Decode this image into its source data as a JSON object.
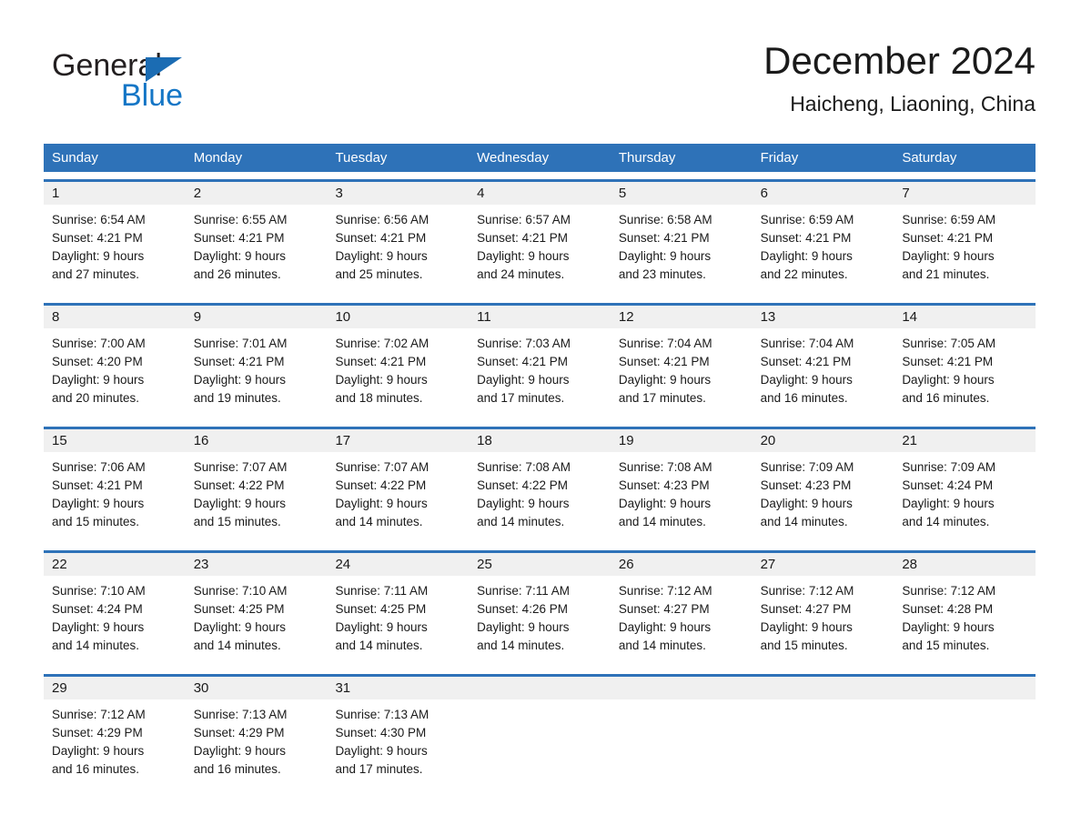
{
  "brand": {
    "name_part1": "General",
    "name_part2": "Blue"
  },
  "header": {
    "month_title": "December 2024",
    "location": "Haicheng, Liaoning, China"
  },
  "colors": {
    "header_blue": "#2e72b8",
    "row_divider_blue": "#2e72b8",
    "day_band_gray": "#f0f0f0",
    "logo_blue": "#1476c6",
    "text": "#1a1a1a"
  },
  "weekday_headers": [
    "Sunday",
    "Monday",
    "Tuesday",
    "Wednesday",
    "Thursday",
    "Friday",
    "Saturday"
  ],
  "weeks": [
    {
      "numbers": [
        "1",
        "2",
        "3",
        "4",
        "5",
        "6",
        "7"
      ],
      "days": [
        {
          "sunrise": "Sunrise: 6:54 AM",
          "sunset": "Sunset: 4:21 PM",
          "daylight1": "Daylight: 9 hours",
          "daylight2": "and 27 minutes."
        },
        {
          "sunrise": "Sunrise: 6:55 AM",
          "sunset": "Sunset: 4:21 PM",
          "daylight1": "Daylight: 9 hours",
          "daylight2": "and 26 minutes."
        },
        {
          "sunrise": "Sunrise: 6:56 AM",
          "sunset": "Sunset: 4:21 PM",
          "daylight1": "Daylight: 9 hours",
          "daylight2": "and 25 minutes."
        },
        {
          "sunrise": "Sunrise: 6:57 AM",
          "sunset": "Sunset: 4:21 PM",
          "daylight1": "Daylight: 9 hours",
          "daylight2": "and 24 minutes."
        },
        {
          "sunrise": "Sunrise: 6:58 AM",
          "sunset": "Sunset: 4:21 PM",
          "daylight1": "Daylight: 9 hours",
          "daylight2": "and 23 minutes."
        },
        {
          "sunrise": "Sunrise: 6:59 AM",
          "sunset": "Sunset: 4:21 PM",
          "daylight1": "Daylight: 9 hours",
          "daylight2": "and 22 minutes."
        },
        {
          "sunrise": "Sunrise: 6:59 AM",
          "sunset": "Sunset: 4:21 PM",
          "daylight1": "Daylight: 9 hours",
          "daylight2": "and 21 minutes."
        }
      ]
    },
    {
      "numbers": [
        "8",
        "9",
        "10",
        "11",
        "12",
        "13",
        "14"
      ],
      "days": [
        {
          "sunrise": "Sunrise: 7:00 AM",
          "sunset": "Sunset: 4:20 PM",
          "daylight1": "Daylight: 9 hours",
          "daylight2": "and 20 minutes."
        },
        {
          "sunrise": "Sunrise: 7:01 AM",
          "sunset": "Sunset: 4:21 PM",
          "daylight1": "Daylight: 9 hours",
          "daylight2": "and 19 minutes."
        },
        {
          "sunrise": "Sunrise: 7:02 AM",
          "sunset": "Sunset: 4:21 PM",
          "daylight1": "Daylight: 9 hours",
          "daylight2": "and 18 minutes."
        },
        {
          "sunrise": "Sunrise: 7:03 AM",
          "sunset": "Sunset: 4:21 PM",
          "daylight1": "Daylight: 9 hours",
          "daylight2": "and 17 minutes."
        },
        {
          "sunrise": "Sunrise: 7:04 AM",
          "sunset": "Sunset: 4:21 PM",
          "daylight1": "Daylight: 9 hours",
          "daylight2": "and 17 minutes."
        },
        {
          "sunrise": "Sunrise: 7:04 AM",
          "sunset": "Sunset: 4:21 PM",
          "daylight1": "Daylight: 9 hours",
          "daylight2": "and 16 minutes."
        },
        {
          "sunrise": "Sunrise: 7:05 AM",
          "sunset": "Sunset: 4:21 PM",
          "daylight1": "Daylight: 9 hours",
          "daylight2": "and 16 minutes."
        }
      ]
    },
    {
      "numbers": [
        "15",
        "16",
        "17",
        "18",
        "19",
        "20",
        "21"
      ],
      "days": [
        {
          "sunrise": "Sunrise: 7:06 AM",
          "sunset": "Sunset: 4:21 PM",
          "daylight1": "Daylight: 9 hours",
          "daylight2": "and 15 minutes."
        },
        {
          "sunrise": "Sunrise: 7:07 AM",
          "sunset": "Sunset: 4:22 PM",
          "daylight1": "Daylight: 9 hours",
          "daylight2": "and 15 minutes."
        },
        {
          "sunrise": "Sunrise: 7:07 AM",
          "sunset": "Sunset: 4:22 PM",
          "daylight1": "Daylight: 9 hours",
          "daylight2": "and 14 minutes."
        },
        {
          "sunrise": "Sunrise: 7:08 AM",
          "sunset": "Sunset: 4:22 PM",
          "daylight1": "Daylight: 9 hours",
          "daylight2": "and 14 minutes."
        },
        {
          "sunrise": "Sunrise: 7:08 AM",
          "sunset": "Sunset: 4:23 PM",
          "daylight1": "Daylight: 9 hours",
          "daylight2": "and 14 minutes."
        },
        {
          "sunrise": "Sunrise: 7:09 AM",
          "sunset": "Sunset: 4:23 PM",
          "daylight1": "Daylight: 9 hours",
          "daylight2": "and 14 minutes."
        },
        {
          "sunrise": "Sunrise: 7:09 AM",
          "sunset": "Sunset: 4:24 PM",
          "daylight1": "Daylight: 9 hours",
          "daylight2": "and 14 minutes."
        }
      ]
    },
    {
      "numbers": [
        "22",
        "23",
        "24",
        "25",
        "26",
        "27",
        "28"
      ],
      "days": [
        {
          "sunrise": "Sunrise: 7:10 AM",
          "sunset": "Sunset: 4:24 PM",
          "daylight1": "Daylight: 9 hours",
          "daylight2": "and 14 minutes."
        },
        {
          "sunrise": "Sunrise: 7:10 AM",
          "sunset": "Sunset: 4:25 PM",
          "daylight1": "Daylight: 9 hours",
          "daylight2": "and 14 minutes."
        },
        {
          "sunrise": "Sunrise: 7:11 AM",
          "sunset": "Sunset: 4:25 PM",
          "daylight1": "Daylight: 9 hours",
          "daylight2": "and 14 minutes."
        },
        {
          "sunrise": "Sunrise: 7:11 AM",
          "sunset": "Sunset: 4:26 PM",
          "daylight1": "Daylight: 9 hours",
          "daylight2": "and 14 minutes."
        },
        {
          "sunrise": "Sunrise: 7:12 AM",
          "sunset": "Sunset: 4:27 PM",
          "daylight1": "Daylight: 9 hours",
          "daylight2": "and 14 minutes."
        },
        {
          "sunrise": "Sunrise: 7:12 AM",
          "sunset": "Sunset: 4:27 PM",
          "daylight1": "Daylight: 9 hours",
          "daylight2": "and 15 minutes."
        },
        {
          "sunrise": "Sunrise: 7:12 AM",
          "sunset": "Sunset: 4:28 PM",
          "daylight1": "Daylight: 9 hours",
          "daylight2": "and 15 minutes."
        }
      ]
    },
    {
      "numbers": [
        "29",
        "30",
        "31",
        "",
        "",
        "",
        ""
      ],
      "days": [
        {
          "sunrise": "Sunrise: 7:12 AM",
          "sunset": "Sunset: 4:29 PM",
          "daylight1": "Daylight: 9 hours",
          "daylight2": "and 16 minutes."
        },
        {
          "sunrise": "Sunrise: 7:13 AM",
          "sunset": "Sunset: 4:29 PM",
          "daylight1": "Daylight: 9 hours",
          "daylight2": "and 16 minutes."
        },
        {
          "sunrise": "Sunrise: 7:13 AM",
          "sunset": "Sunset: 4:30 PM",
          "daylight1": "Daylight: 9 hours",
          "daylight2": "and 17 minutes."
        },
        {
          "sunrise": "",
          "sunset": "",
          "daylight1": "",
          "daylight2": ""
        },
        {
          "sunrise": "",
          "sunset": "",
          "daylight1": "",
          "daylight2": ""
        },
        {
          "sunrise": "",
          "sunset": "",
          "daylight1": "",
          "daylight2": ""
        },
        {
          "sunrise": "",
          "sunset": "",
          "daylight1": "",
          "daylight2": ""
        }
      ]
    }
  ]
}
